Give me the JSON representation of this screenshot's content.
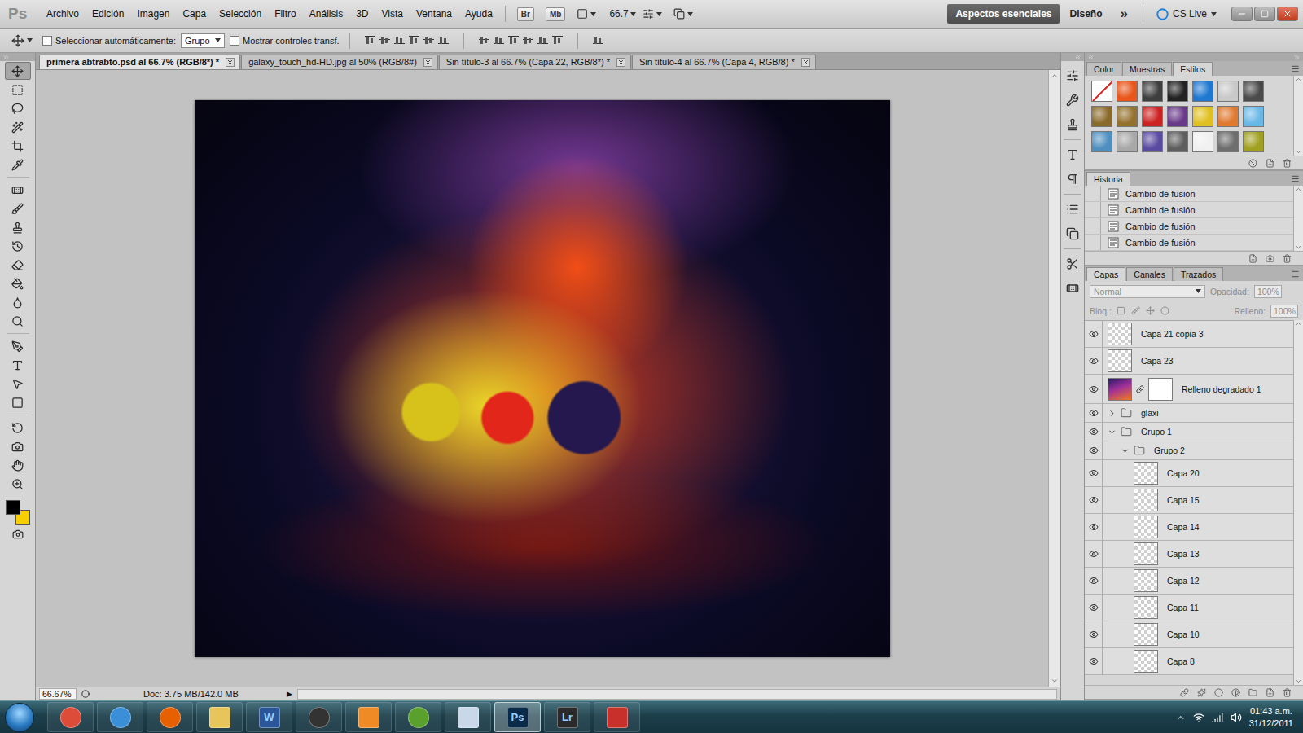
{
  "app": {
    "logo": "Ps"
  },
  "menu": [
    "Archivo",
    "Edición",
    "Imagen",
    "Capa",
    "Selección",
    "Filtro",
    "Análisis",
    "3D",
    "Vista",
    "Ventana",
    "Ayuda"
  ],
  "header_buttons": {
    "bridge": "Br",
    "mini_bridge": "Mb",
    "zoom": "66.7"
  },
  "workspaces": [
    {
      "label": "Aspectos esenciales",
      "selected": true
    },
    {
      "label": "Diseño",
      "selected": false
    }
  ],
  "overflow": "»",
  "cs_live": "CS Live",
  "options_bar": {
    "auto_select": {
      "label": "Seleccionar automáticamente:",
      "checked": false
    },
    "auto_select_target": "Grupo",
    "show_transform": {
      "label": "Mostrar controles transf.",
      "checked": false
    }
  },
  "documents": [
    {
      "label": "primera abtrabto.psd al 66.7% (RGB/8*) *",
      "selected": true
    },
    {
      "label": "galaxy_touch_hd-HD.jpg al 50% (RGB/8#)",
      "selected": false
    },
    {
      "label": "Sin título-3 al 66.7% (Capa 22, RGB/8*) *",
      "selected": false
    },
    {
      "label": "Sin título-4 al 66.7% (Capa 4, RGB/8) *",
      "selected": false
    }
  ],
  "toolbar": {
    "tools": [
      {
        "selected": true
      },
      {
        "selected": false
      },
      {
        "selected": false
      },
      {
        "selected": false
      },
      {
        "selected": false
      },
      {
        "selected": false
      },
      {
        "selected": false
      },
      {
        "selected": false
      },
      {
        "selected": false
      },
      {
        "selected": false
      },
      {
        "selected": false
      },
      {
        "selected": false
      },
      {
        "selected": false
      },
      {
        "selected": false
      },
      {
        "selected": false
      },
      {
        "selected": false
      },
      {
        "selected": false
      },
      {
        "selected": false
      },
      {
        "selected": false
      },
      {
        "selected": false
      },
      {
        "selected": false
      },
      {
        "selected": false
      }
    ],
    "colors": {
      "foreground": "#000000",
      "background": "#f5cf00"
    }
  },
  "status_bar": {
    "zoom": "66.67%",
    "doc": "Doc: 3.75 MB/142.0 MB",
    "arrow": "▶"
  },
  "styles_panel": {
    "tabs": [
      {
        "label": "Color",
        "selected": false
      },
      {
        "label": "Muestras",
        "selected": false
      },
      {
        "label": "Estilos",
        "selected": true
      }
    ],
    "swatches": [
      {
        "kind": "none",
        "color": "#ffffff"
      },
      {
        "kind": "fill",
        "color": "#e8561a"
      },
      {
        "kind": "fill",
        "color": "#3e3e3e"
      },
      {
        "kind": "fill",
        "color": "#222222"
      },
      {
        "kind": "fill",
        "color": "#1e78d0"
      },
      {
        "kind": "fill",
        "color": "#c8c8c8"
      },
      {
        "kind": "fill",
        "color": "#4a4a4a"
      },
      {
        "kind": "fill",
        "color": "#8a6a2a"
      },
      {
        "kind": "fill",
        "color": "#94712e"
      },
      {
        "kind": "fill",
        "color": "#cc2222"
      },
      {
        "kind": "fill",
        "color": "#6a3a8a"
      },
      {
        "kind": "fill",
        "color": "#e0c020"
      },
      {
        "kind": "fill",
        "color": "#e07a30"
      },
      {
        "kind": "fill",
        "color": "#6ab8e6"
      },
      {
        "kind": "fill",
        "color": "#4f8fc0"
      },
      {
        "kind": "fill",
        "color": "#a8a8a8"
      },
      {
        "kind": "fill",
        "color": "#5a4aa0"
      },
      {
        "kind": "fill",
        "color": "#5e5e5e"
      },
      {
        "kind": "fill",
        "color": "#f0f0f0"
      },
      {
        "kind": "fill",
        "color": "#6e6e6e"
      },
      {
        "kind": "fill",
        "color": "#a0a020"
      }
    ]
  },
  "history_panel": {
    "tabs": [
      {
        "label": "Historia",
        "selected": true
      }
    ],
    "items": [
      {
        "label": "Cambio de fusión",
        "selected": false
      },
      {
        "label": "Cambio de fusión",
        "selected": false
      },
      {
        "label": "Cambio de fusión",
        "selected": false
      },
      {
        "label": "Cambio de fusión",
        "selected": false
      }
    ]
  },
  "layers_panel": {
    "tabs": [
      {
        "label": "Capas",
        "selected": true
      },
      {
        "label": "Canales",
        "selected": false
      },
      {
        "label": "Trazados",
        "selected": false
      }
    ],
    "blend_mode": "Normal",
    "opacity_label": "Opacidad:",
    "opacity": "100%",
    "lock_label": "Bloq.:",
    "fill_label": "Relleno:",
    "fill": "100%",
    "controls_disabled": true,
    "layers": [
      {
        "name": "Capa 21 copia 3",
        "kind": "layer",
        "visible": true,
        "depth": 0,
        "expanded": false,
        "selected": false
      },
      {
        "name": "Capa 23",
        "kind": "layer",
        "visible": true,
        "depth": 0,
        "expanded": false,
        "selected": false
      },
      {
        "name": "Relleno degradado 1",
        "kind": "fill",
        "visible": true,
        "depth": 0,
        "expanded": false,
        "selected": false
      },
      {
        "name": "glaxi",
        "kind": "group",
        "visible": true,
        "depth": 0,
        "expanded": false,
        "selected": false
      },
      {
        "name": "Grupo 1",
        "kind": "group",
        "visible": true,
        "depth": 0,
        "expanded": true,
        "selected": false
      },
      {
        "name": "Grupo 2",
        "kind": "group",
        "visible": true,
        "depth": 1,
        "expanded": true,
        "selected": false
      },
      {
        "name": "Capa 20",
        "kind": "layer",
        "visible": true,
        "depth": 2,
        "expanded": false,
        "selected": false
      },
      {
        "name": "Capa 15",
        "kind": "layer",
        "visible": true,
        "depth": 2,
        "expanded": false,
        "selected": false
      },
      {
        "name": "Capa 14",
        "kind": "layer",
        "visible": true,
        "depth": 2,
        "expanded": false,
        "selected": false
      },
      {
        "name": "Capa 13",
        "kind": "layer",
        "visible": true,
        "depth": 2,
        "expanded": false,
        "selected": false
      },
      {
        "name": "Capa 12",
        "kind": "layer",
        "visible": true,
        "depth": 2,
        "expanded": false,
        "selected": false
      },
      {
        "name": "Capa 11",
        "kind": "layer",
        "visible": true,
        "depth": 2,
        "expanded": false,
        "selected": false
      },
      {
        "name": "Capa 10",
        "kind": "layer",
        "visible": true,
        "depth": 2,
        "expanded": false,
        "selected": false
      },
      {
        "name": "Capa 8",
        "kind": "layer",
        "visible": true,
        "depth": 2,
        "expanded": false,
        "selected": false
      }
    ]
  },
  "taskbar": {
    "apps": [
      {
        "kind": "circle",
        "color": "#dd4b39",
        "label": "",
        "active": false
      },
      {
        "kind": "circle",
        "color": "#3b8fd9",
        "label": "",
        "active": false
      },
      {
        "kind": "circle",
        "color": "#e66000",
        "label": "",
        "active": false
      },
      {
        "kind": "square",
        "color": "#e8c55a",
        "label": "",
        "active": false
      },
      {
        "kind": "square",
        "color": "#2b579a",
        "label": "W",
        "active": false
      },
      {
        "kind": "circle",
        "color": "#333333",
        "label": "",
        "active": false
      },
      {
        "kind": "square",
        "color": "#f08a24",
        "label": "",
        "active": false
      },
      {
        "kind": "circle",
        "color": "#5aa02c",
        "label": "",
        "active": false
      },
      {
        "kind": "square",
        "color": "#c8d8e8",
        "label": "",
        "active": false
      },
      {
        "kind": "square",
        "color": "#0a2a4a",
        "label": "Ps",
        "active": true
      },
      {
        "kind": "square",
        "color": "#2a2a2a",
        "label": "Lr",
        "active": false
      },
      {
        "kind": "square",
        "color": "#c8302c",
        "label": "",
        "active": false
      }
    ],
    "time": "01:43 a.m.",
    "date": "31/12/2011"
  }
}
